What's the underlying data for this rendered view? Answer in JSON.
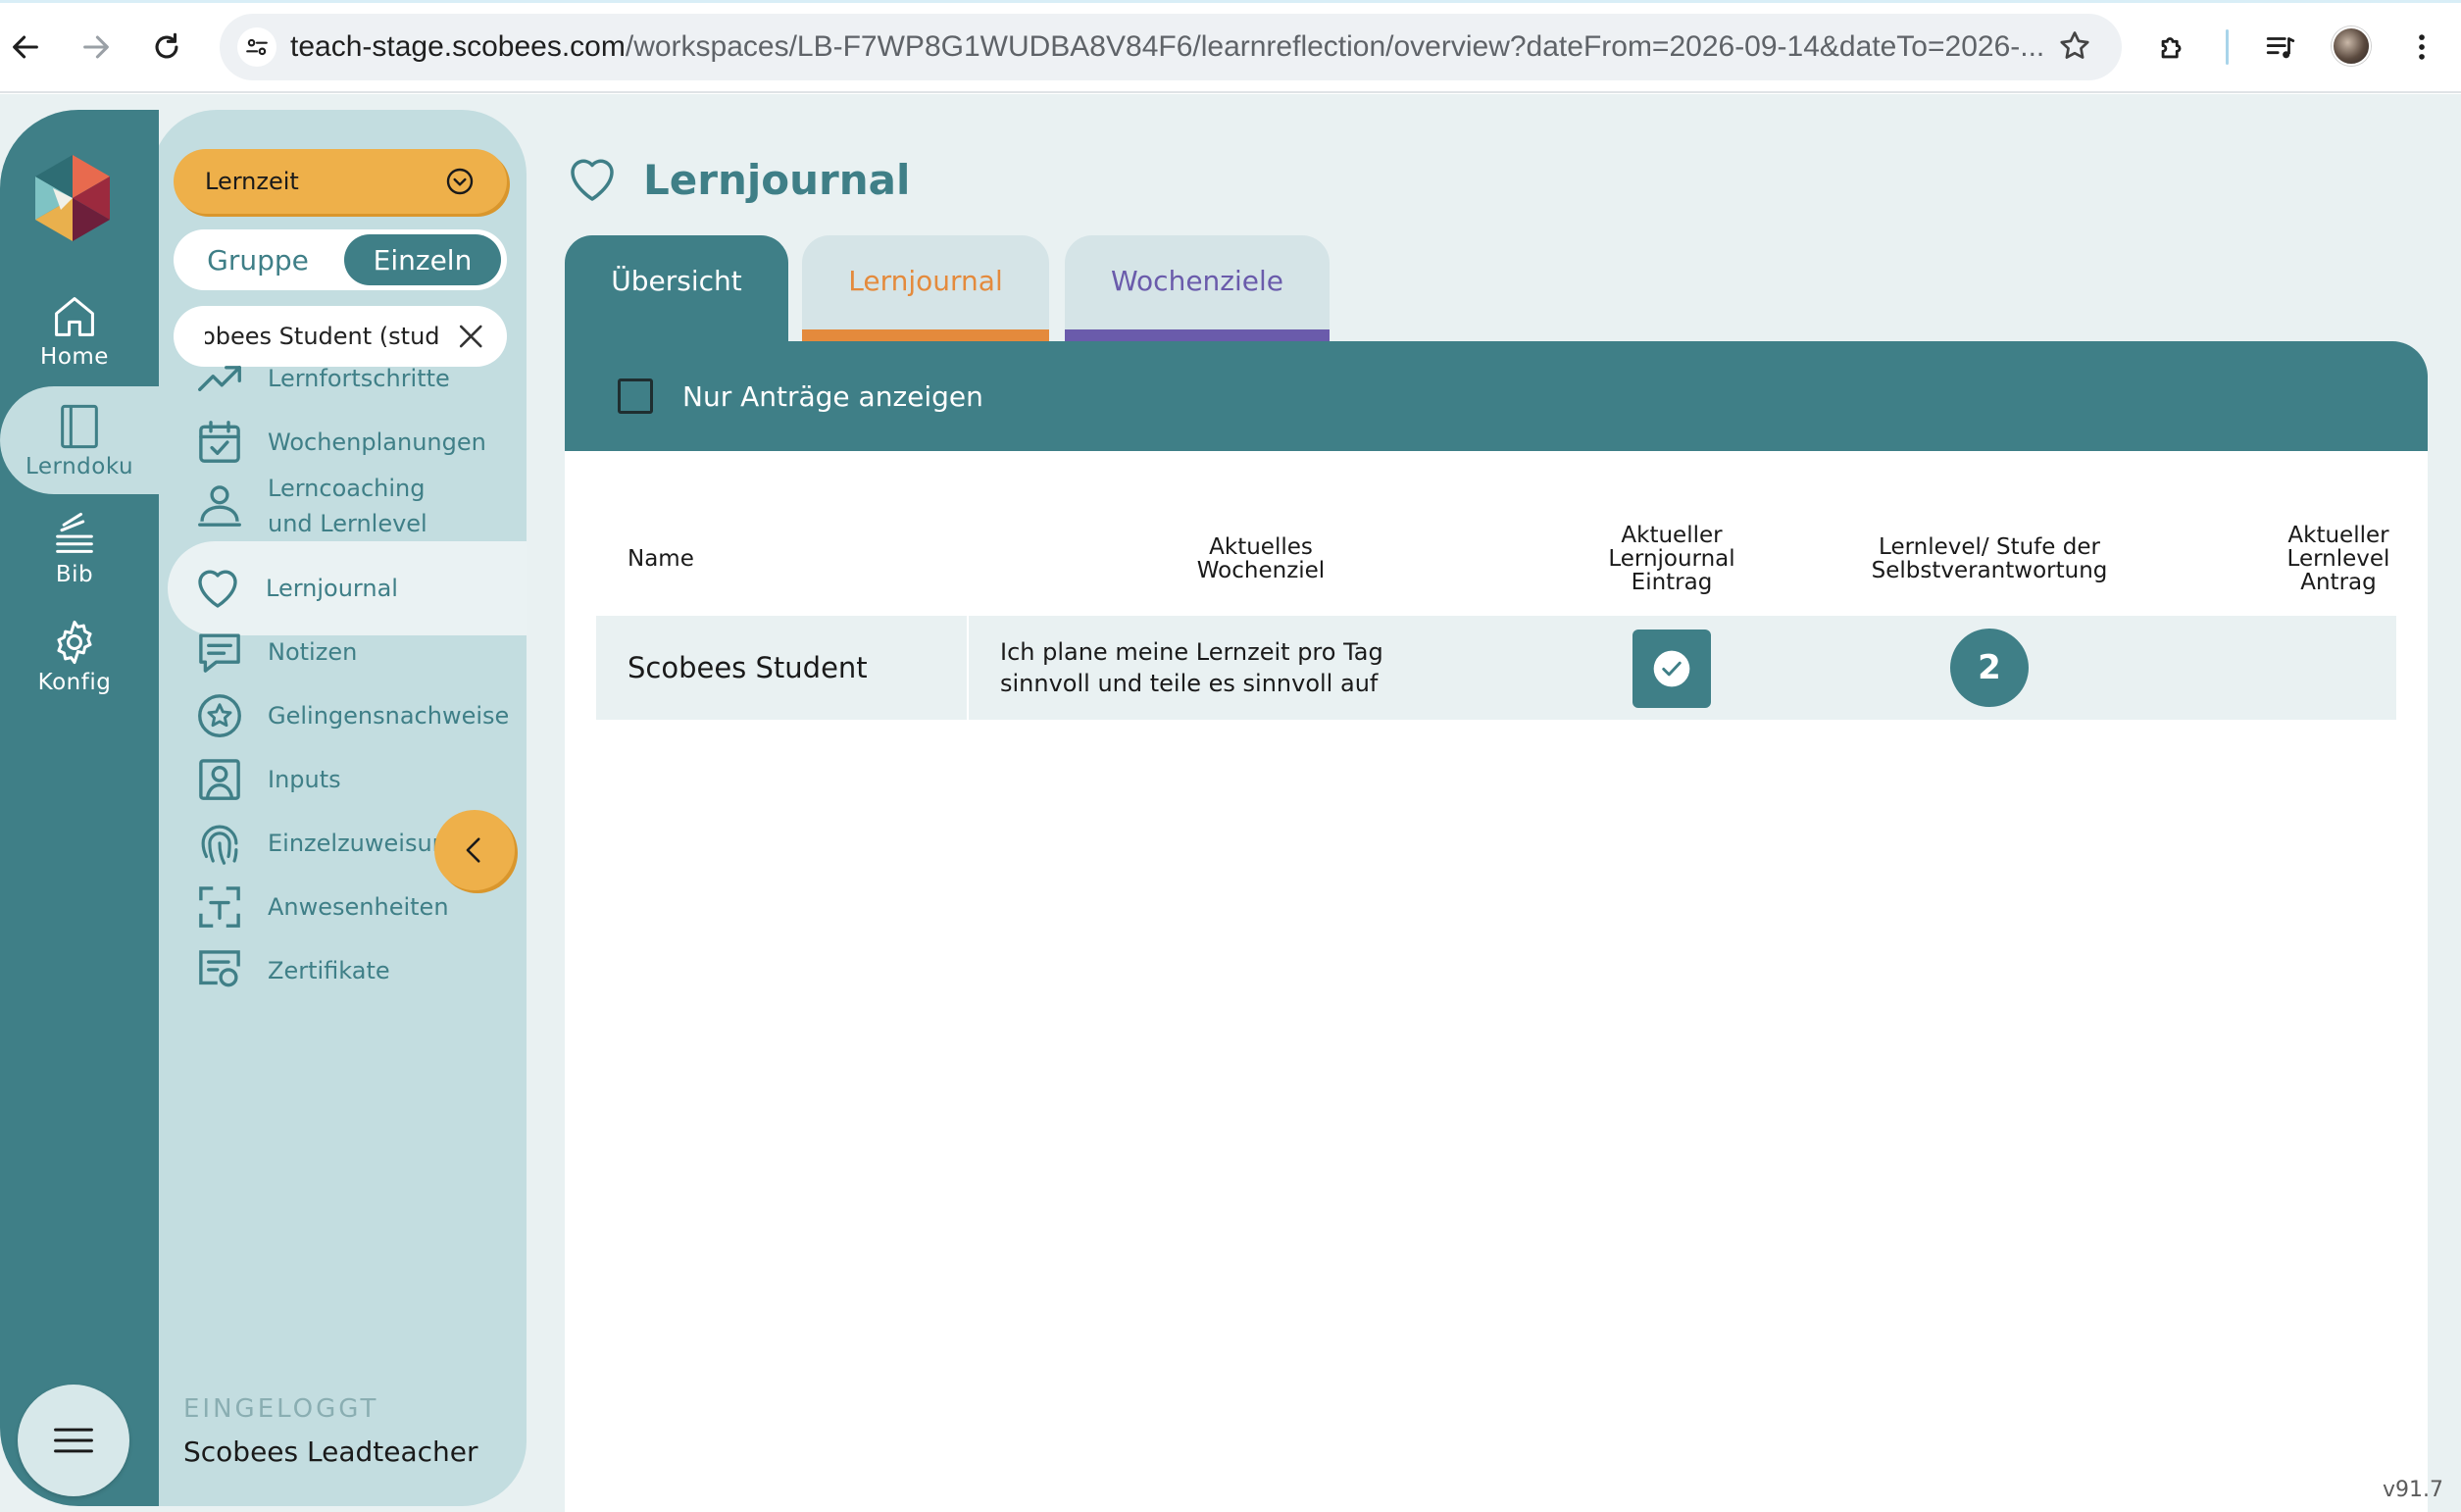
{
  "browser": {
    "url_host": "teach-stage.scobees.com",
    "url_path": "/workspaces/LB-F7WP8G1WUDBA8V84F6/learnreflection/overview?dateFrom=2026-09-14&dateTo=2026-..."
  },
  "rail": {
    "items": [
      {
        "label": "Home",
        "icon": "home-icon"
      },
      {
        "label": "Lerndoku",
        "icon": "notebook-icon"
      },
      {
        "label": "Bib",
        "icon": "library-icon"
      },
      {
        "label": "Konfig",
        "icon": "gear-icon"
      }
    ],
    "active": "Lerndoku"
  },
  "panel": {
    "mode_select": "Lernzeit",
    "toggle": {
      "group": "Gruppe",
      "single": "Einzeln",
      "selected": "Einzeln"
    },
    "student_chip": "Scobees Student (stud",
    "nav": [
      {
        "label": "Lernfortschritte",
        "icon": "trend-up-icon"
      },
      {
        "label": "Wochenplanungen",
        "icon": "calendar-check-icon"
      },
      {
        "label": "Lerncoaching und Lernlevel",
        "icon": "coaching-icon"
      },
      {
        "label": "Lernjournal",
        "icon": "heart-icon"
      },
      {
        "label": "Notizen",
        "icon": "speech-bubble-icon"
      },
      {
        "label": "Gelingensnachweise",
        "icon": "star-badge-icon"
      },
      {
        "label": "Inputs",
        "icon": "person-frame-icon"
      },
      {
        "label": "Einzelzuweisungen",
        "icon": "fingerprint-icon"
      },
      {
        "label": "Anwesenheiten",
        "icon": "attendance-icon"
      },
      {
        "label": "Zertifikate",
        "icon": "certificate-icon"
      }
    ],
    "active": "Lernjournal",
    "logged_in_label": "EINGELOGGT",
    "logged_in_name": "Scobees Leadteacher"
  },
  "page": {
    "title": "Lernjournal",
    "tabs": [
      {
        "label": "Übersicht",
        "color": "#3f7f87"
      },
      {
        "label": "Lernjournal",
        "color": "#e48a3c"
      },
      {
        "label": "Wochenziele",
        "color": "#6a5bab"
      }
    ],
    "active_tab": "Übersicht",
    "filter_label": "Nur Anträge anzeigen",
    "filter_checked": false,
    "columns": [
      "Name",
      "Aktuelles Wochenziel",
      "Aktueller Lernjournal Eintrag",
      "Lernlevel/ Stufe der Selbstverantwortung",
      "Aktueller Lernlevel Antrag"
    ],
    "rows": [
      {
        "name": "Scobees Student",
        "goal": "Ich plane meine Lernzeit pro Tag sinnvoll und teile es sinnvoll auf",
        "journal_entry": true,
        "level": "2",
        "level_request": ""
      }
    ]
  },
  "version": "v91.7",
  "colors": {
    "teal": "#3f7f87",
    "panel": "#c3dde0",
    "accent": "#eeb04a",
    "orange": "#e48a3c",
    "purple": "#6a5bab"
  }
}
